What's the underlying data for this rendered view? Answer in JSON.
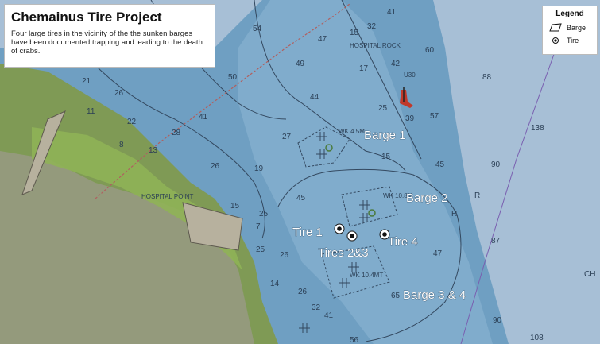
{
  "info": {
    "title": "Chemainus Tire Project",
    "description": "Four large tires in the vicinity of the the sunken barges have been documented trapping and leading to the death of crabs."
  },
  "legend": {
    "title": "Legend",
    "items": [
      {
        "label": "Barge",
        "icon": "barge-outline-icon"
      },
      {
        "label": "Tire",
        "icon": "tire-dot-icon"
      }
    ]
  },
  "labels": {
    "barge1": "Barge 1",
    "barge2": "Barge 2",
    "barge34": "Barge 3 & 4",
    "tire1": "Tire 1",
    "tires23": "Tires 2&3",
    "tire4": "Tire 4"
  },
  "chart_text": {
    "hospital_rock": "HOSPITAL ROCK",
    "hospital_point": "HOSPITAL POINT",
    "wreck1": "WK 4.5M",
    "wreck2": "WK 10.8M",
    "wreck3": "WK 10.4MT",
    "chem": "CH",
    "u30": "U30"
  },
  "soundings": {
    "s1": "41",
    "s2": "54",
    "s3": "47",
    "s4": "15",
    "s5": "32",
    "s6": "49",
    "s7": "60",
    "s8": "50",
    "s9": "17",
    "s10": "42",
    "s11": "88",
    "s12": "21",
    "s13": "26",
    "s14": "11",
    "s15": "44",
    "s16": "25",
    "s17": "39",
    "s18": "57",
    "s19": "138",
    "s20": "22",
    "s21": "41",
    "s22": "27",
    "s23": "28",
    "s24": "8",
    "s25": "13",
    "s26": "26",
    "s27": "19",
    "s28": "15",
    "s29": "45",
    "s30": "90",
    "s31": "R",
    "s32": "45",
    "s33": "25",
    "s34": "15",
    "s35": "14",
    "s36": "25",
    "s37": "26",
    "s38": "32",
    "s39": "41",
    "s40": "65",
    "s41": "87",
    "s42": "47",
    "s43": "90",
    "s44": "108",
    "s45": "R",
    "s46": "26",
    "s47": "56",
    "s48": "7"
  },
  "colors": {
    "deep_water": "#a7bfd6",
    "shallow_water": "#6f9fc2",
    "land": "#7f9a55",
    "tire": "#111111",
    "label_text": "#ffffff"
  }
}
